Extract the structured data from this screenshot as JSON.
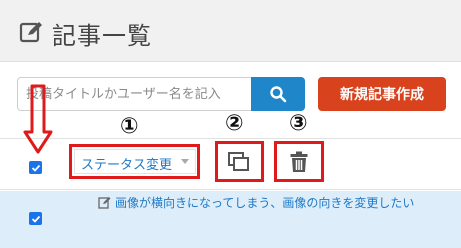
{
  "header": {
    "title": "記事一覧",
    "icon": "edit-square-icon"
  },
  "search": {
    "placeholder": "投稿タイトルかユーザー名を記入",
    "button_icon": "search-icon"
  },
  "toolbar": {
    "create_label": "新規記事作成",
    "status_select_value": "ステータス変更",
    "copy_icon": "copy-icon",
    "delete_icon": "trash-icon"
  },
  "annotations": {
    "n1": "①",
    "n2": "②",
    "n3": "③"
  },
  "rows": [
    {
      "title": "画像が横向きになってしまう、画像の向きを変更したい",
      "checked": true
    }
  ],
  "colors": {
    "accent": "#1f86c9",
    "create": "#d8421d",
    "highlight": "#e01a1a",
    "row_bg": "#ddeefa"
  }
}
